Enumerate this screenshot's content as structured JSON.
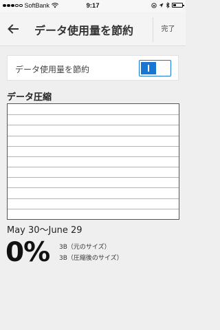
{
  "status_bar": {
    "carrier": "SoftBank",
    "time": "9:17",
    "signal_bars": 3
  },
  "header": {
    "title": "データ使用量を節約",
    "done_label": "完了"
  },
  "data_saver": {
    "label": "データ使用量を節約",
    "toggle_on": true,
    "accent_color": "#1976d2"
  },
  "compression": {
    "title": "データ圧縮",
    "date_range": "May 30〜June 29",
    "percent": "0%",
    "original_size": "3B（元のサイズ）",
    "compressed_size": "3B（圧縮後のサイズ）"
  },
  "chart_data": {
    "type": "line",
    "title": "データ圧縮",
    "x": [],
    "series": [],
    "grid": true,
    "gridline_count": 10
  }
}
